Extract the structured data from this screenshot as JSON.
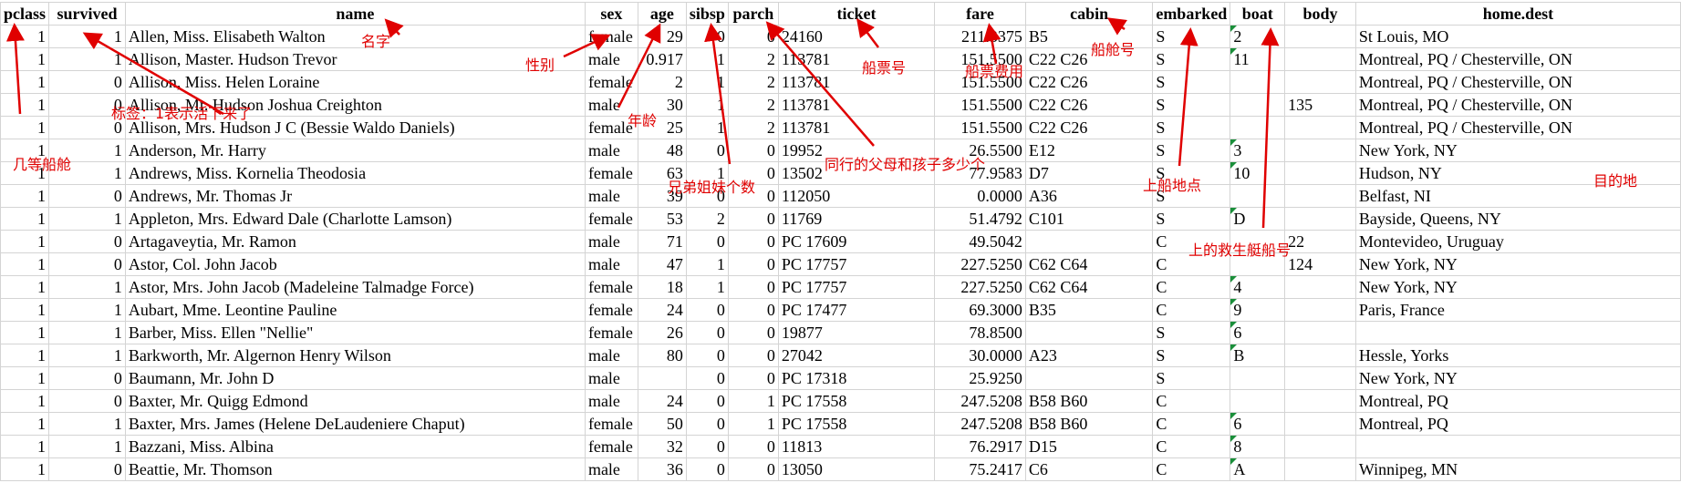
{
  "columns": [
    "pclass",
    "survived",
    "name",
    "sex",
    "age",
    "sibsp",
    "parch",
    "ticket",
    "fare",
    "cabin",
    "embarked",
    "boat",
    "body",
    "home.dest"
  ],
  "rows": [
    [
      "1",
      "1",
      "Allen, Miss. Elisabeth Walton",
      "female",
      "29",
      "0",
      "0",
      "24160",
      "211.3375",
      "B5",
      "S",
      "2",
      "",
      "St Louis, MO"
    ],
    [
      "1",
      "1",
      "Allison, Master. Hudson Trevor",
      "male",
      "0.917",
      "1",
      "2",
      "113781",
      "151.5500",
      "C22 C26",
      "S",
      "11",
      "",
      "Montreal, PQ / Chesterville, ON"
    ],
    [
      "1",
      "0",
      "Allison, Miss. Helen Loraine",
      "female",
      "2",
      "1",
      "2",
      "113781",
      "151.5500",
      "C22 C26",
      "S",
      "",
      "",
      "Montreal, PQ / Chesterville, ON"
    ],
    [
      "1",
      "0",
      "Allison, Mr. Hudson Joshua Creighton",
      "male",
      "30",
      "1",
      "2",
      "113781",
      "151.5500",
      "C22 C26",
      "S",
      "",
      "135",
      "Montreal, PQ / Chesterville, ON"
    ],
    [
      "1",
      "0",
      "Allison, Mrs. Hudson J C (Bessie Waldo Daniels)",
      "female",
      "25",
      "1",
      "2",
      "113781",
      "151.5500",
      "C22 C26",
      "S",
      "",
      "",
      "Montreal, PQ / Chesterville, ON"
    ],
    [
      "1",
      "1",
      "Anderson, Mr. Harry",
      "male",
      "48",
      "0",
      "0",
      "19952",
      "26.5500",
      "E12",
      "S",
      "3",
      "",
      "New York, NY"
    ],
    [
      "1",
      "1",
      "Andrews, Miss. Kornelia Theodosia",
      "female",
      "63",
      "1",
      "0",
      "13502",
      "77.9583",
      "D7",
      "S",
      "10",
      "",
      "Hudson, NY"
    ],
    [
      "1",
      "0",
      "Andrews, Mr. Thomas Jr",
      "male",
      "39",
      "0",
      "0",
      "112050",
      "0.0000",
      "A36",
      "S",
      "",
      "",
      "Belfast, NI"
    ],
    [
      "1",
      "1",
      "Appleton, Mrs. Edward Dale (Charlotte Lamson)",
      "female",
      "53",
      "2",
      "0",
      "11769",
      "51.4792",
      "C101",
      "S",
      "D",
      "",
      "Bayside, Queens, NY"
    ],
    [
      "1",
      "0",
      "Artagaveytia, Mr. Ramon",
      "male",
      "71",
      "0",
      "0",
      "PC 17609",
      "49.5042",
      "",
      "C",
      "",
      "22",
      "Montevideo, Uruguay"
    ],
    [
      "1",
      "0",
      "Astor, Col. John Jacob",
      "male",
      "47",
      "1",
      "0",
      "PC 17757",
      "227.5250",
      "C62 C64",
      "C",
      "",
      "124",
      "New York, NY"
    ],
    [
      "1",
      "1",
      "Astor, Mrs. John Jacob (Madeleine Talmadge Force)",
      "female",
      "18",
      "1",
      "0",
      "PC 17757",
      "227.5250",
      "C62 C64",
      "C",
      "4",
      "",
      "New York, NY"
    ],
    [
      "1",
      "1",
      "Aubart, Mme. Leontine Pauline",
      "female",
      "24",
      "0",
      "0",
      "PC 17477",
      "69.3000",
      "B35",
      "C",
      "9",
      "",
      "Paris, France"
    ],
    [
      "1",
      "1",
      "Barber, Miss. Ellen \"Nellie\"",
      "female",
      "26",
      "0",
      "0",
      "19877",
      "78.8500",
      "",
      "S",
      "6",
      "",
      ""
    ],
    [
      "1",
      "1",
      "Barkworth, Mr. Algernon Henry Wilson",
      "male",
      "80",
      "0",
      "0",
      "27042",
      "30.0000",
      "A23",
      "S",
      "B",
      "",
      "Hessle, Yorks"
    ],
    [
      "1",
      "0",
      "Baumann, Mr. John D",
      "male",
      "",
      "0",
      "0",
      "PC 17318",
      "25.9250",
      "",
      "S",
      "",
      "",
      "New York, NY"
    ],
    [
      "1",
      "0",
      "Baxter, Mr. Quigg Edmond",
      "male",
      "24",
      "0",
      "1",
      "PC 17558",
      "247.5208",
      "B58 B60",
      "C",
      "",
      "",
      "Montreal, PQ"
    ],
    [
      "1",
      "1",
      "Baxter, Mrs. James (Helene DeLaudeniere Chaput)",
      "female",
      "50",
      "0",
      "1",
      "PC 17558",
      "247.5208",
      "B58 B60",
      "C",
      "6",
      "",
      "Montreal, PQ"
    ],
    [
      "1",
      "1",
      "Bazzani, Miss. Albina",
      "female",
      "32",
      "0",
      "0",
      "11813",
      "76.2917",
      "D15",
      "C",
      "8",
      "",
      ""
    ],
    [
      "1",
      "0",
      "Beattie, Mr. Thomson",
      "male",
      "36",
      "0",
      "0",
      "13050",
      "75.2417",
      "C6",
      "C",
      "A",
      "",
      "Winnipeg, MN"
    ]
  ],
  "annotations": [
    {
      "id": "pclass",
      "text": "几等船舱"
    },
    {
      "id": "survived",
      "text": "标签：1表示活下来了"
    },
    {
      "id": "name",
      "text": "名字"
    },
    {
      "id": "sex",
      "text": "性别"
    },
    {
      "id": "age",
      "text": "年龄"
    },
    {
      "id": "sibsp",
      "text": "兄弟姐妹个数"
    },
    {
      "id": "parch",
      "text": "同行的父母和孩子多少个"
    },
    {
      "id": "ticket",
      "text": "船票号"
    },
    {
      "id": "fare",
      "text": "船票费用"
    },
    {
      "id": "cabin",
      "text": "船舱号"
    },
    {
      "id": "embarked",
      "text": "上船地点"
    },
    {
      "id": "boat",
      "text": "上的救生艇船号"
    },
    {
      "id": "homedest",
      "text": "目的地"
    }
  ],
  "colors": {
    "annotation": "#e00000",
    "grid": "#d4d4d4",
    "comment_flag": "#1a8f3a"
  }
}
